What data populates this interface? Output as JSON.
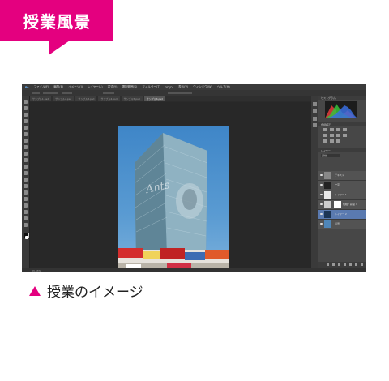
{
  "label_tab": {
    "text": "授業風景",
    "color": "#e4007f"
  },
  "photoshop": {
    "menu": [
      "Ps",
      "ファイル(F)",
      "編集(E)",
      "イメージ(I)",
      "レイヤー(L)",
      "書式(Y)",
      "選択範囲(S)",
      "フィルター(T)",
      "3D(D)",
      "表示(V)",
      "ウィンドウ(W)",
      "ヘルプ(H)"
    ],
    "tabs": [
      {
        "label": "サンプル1.psd",
        "active": false
      },
      {
        "label": "サンプル2.psd",
        "active": false
      },
      {
        "label": "サンプル3.psd",
        "active": false
      },
      {
        "label": "サンプル4.psd",
        "active": false
      },
      {
        "label": "サンプル5.psd",
        "active": false
      },
      {
        "label": "サンプル6.psd",
        "active": true
      }
    ],
    "status_text": "33.33%",
    "panels": {
      "histogram_tab": "ヒストグラム",
      "adjustments_tab": "色調補正",
      "layers_tab": "レイヤー",
      "blend_mode": "通常",
      "layers": [
        {
          "name": "テキスト",
          "selected": false
        },
        {
          "name": "文字",
          "selected": false
        },
        {
          "name": "レイヤー 1",
          "selected": false
        },
        {
          "name": "色相・彩度 1",
          "selected": false
        },
        {
          "name": "レイヤー 2",
          "selected": true
        },
        {
          "name": "背景",
          "selected": false
        }
      ]
    },
    "photo_overlay_text": "Ants"
  },
  "caption": {
    "text": "授業のイメージ",
    "marker_color": "#e4007f"
  }
}
